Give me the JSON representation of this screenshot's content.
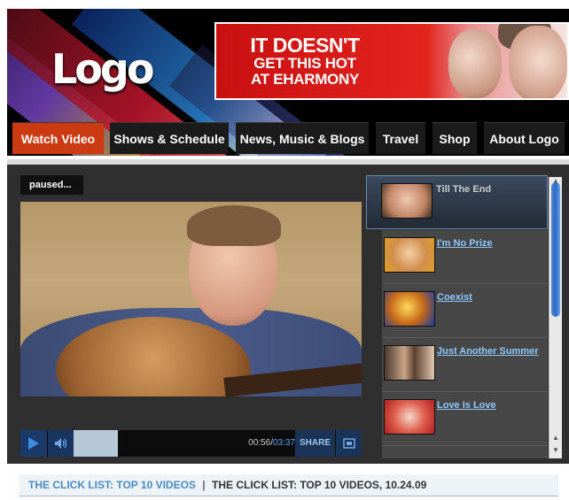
{
  "header": {
    "logo_text": "Logo",
    "ad": {
      "line1": "IT DOESN'T",
      "line2": "GET THIS HOT",
      "line3": "AT EHARMONY"
    }
  },
  "nav": {
    "items": [
      {
        "label": "Watch Video",
        "active": true
      },
      {
        "label": "Shows & Schedule",
        "active": false
      },
      {
        "label": "News, Music & Blogs",
        "active": false
      },
      {
        "label": "Travel",
        "active": false
      },
      {
        "label": "Shop",
        "active": false
      },
      {
        "label": "About Logo",
        "active": false
      }
    ]
  },
  "player": {
    "status": "paused...",
    "time_current": "00:56",
    "time_separator": "/",
    "time_total": "03:37",
    "progress_fraction": 0.258,
    "share_label": "SHARE"
  },
  "playlist": {
    "items": [
      {
        "title": "Till The End",
        "current": true
      },
      {
        "title": "I'm No Prize",
        "current": false
      },
      {
        "title": "Coexist",
        "current": false
      },
      {
        "title": "Just Another Summer",
        "current": false
      },
      {
        "title": "Love Is Love",
        "current": false
      }
    ]
  },
  "clicklist": {
    "link": "THE CLICK LIST: TOP 10 VIDEOS",
    "separator": "|",
    "current": "THE CLICK LIST: TOP 10 VIDEOS, 10.24.09"
  },
  "colors": {
    "nav_active": "#cc3a11",
    "link_blue": "#4a8bc2",
    "playlist_link": "#8fc8ff"
  }
}
